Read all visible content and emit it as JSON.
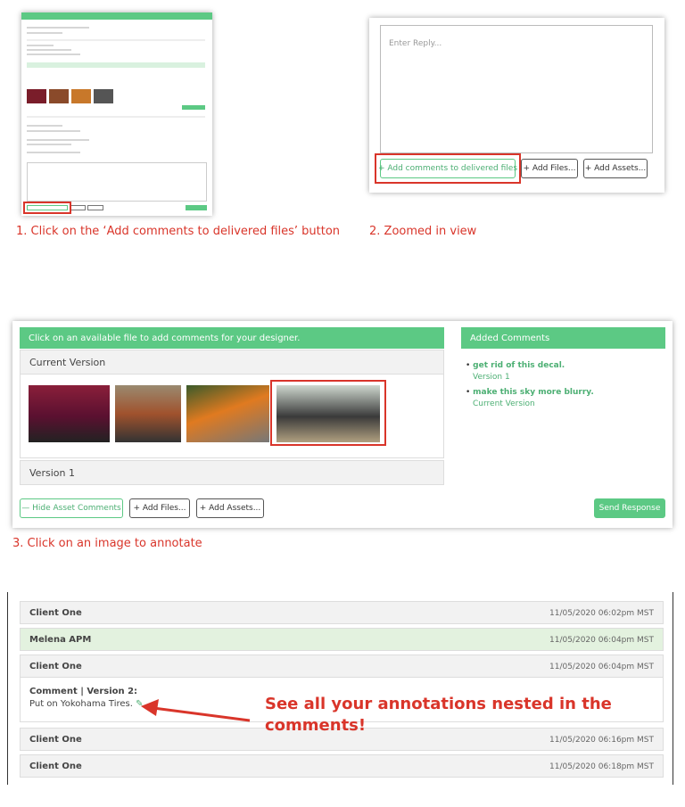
{
  "captions": {
    "step1": "1. Click on the ‘Add comments to delivered files’ button",
    "step2": "2. Zoomed in view",
    "step3": "3. Click on an image to annotate"
  },
  "panel2": {
    "placeholder": "Enter Reply...",
    "add_comments": "+ Add comments to delivered files",
    "add_files": "+ Add Files...",
    "add_assets": "+ Add Assets..."
  },
  "panel3": {
    "header": "Click on an available file to add comments for your designer.",
    "current_version": "Current Version",
    "version1": "Version 1",
    "hide_comments": "— Hide Asset Comments",
    "add_files": "+ Add Files...",
    "add_assets": "+ Add Assets...",
    "send": "Send Response",
    "added_title": "Added Comments",
    "comments": [
      {
        "text": "get rid of this decal.",
        "version": "Version 1"
      },
      {
        "text": "make this sky more blurry.",
        "version": "Current Version"
      }
    ]
  },
  "panel4": {
    "rows": [
      {
        "name": "Client One",
        "time": "11/05/2020 06:02pm MST"
      },
      {
        "name": "Melena APM",
        "time": "11/05/2020 06:04pm MST"
      },
      {
        "name": "Client One",
        "time": "11/05/2020 06:04pm MST"
      },
      {
        "name": "Client One",
        "time": "11/05/2020 06:16pm MST"
      },
      {
        "name": "Client One",
        "time": "11/05/2020 06:18pm MST"
      }
    ],
    "comment_title": "Comment | Version 2:",
    "comment_body": "Put on Yokohama Tires.",
    "annotation": "See all your annotations nested in the comments!"
  },
  "colors": {
    "accent": "#5cc984",
    "red": "#d9352a"
  }
}
